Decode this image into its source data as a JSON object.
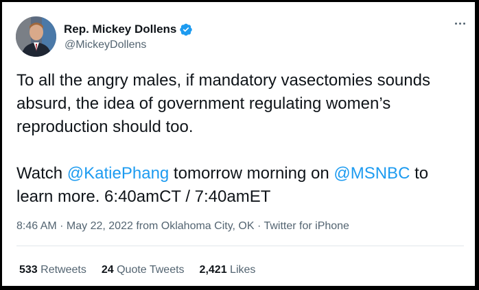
{
  "author": {
    "name": "Rep. Mickey Dollens",
    "handle": "@MickeyDollens",
    "verified": true
  },
  "tweet": {
    "paragraph1": "To all the angry males, if mandatory vasectomies sounds absurd, the idea of government regulating women’s reproduction should too.",
    "p2_prefix": "Watch ",
    "p2_mention1": "@KatiePhang",
    "p2_middle": " tomorrow morning on ",
    "p2_mention2": "@MSNBC",
    "p2_suffix": " to learn more. 6:40amCT / 7:40amET"
  },
  "meta": {
    "time": "8:46 AM",
    "sep1": " · ",
    "date": "May 22, 2022",
    "location_prefix": " from ",
    "location": "Oklahoma City, OK",
    "sep2": " · ",
    "client": "Twitter for iPhone"
  },
  "stats": {
    "retweets_count": "533",
    "retweets_label": "Retweets",
    "quotes_count": "24",
    "quotes_label": "Quote Tweets",
    "likes_count": "2,421",
    "likes_label": "Likes"
  },
  "colors": {
    "accent": "#1d9bf0",
    "text": "#0f1419",
    "muted": "#536471",
    "frame": "#000000"
  },
  "icons": {
    "verified": "verified-badge-icon",
    "more": "more-options-icon"
  }
}
